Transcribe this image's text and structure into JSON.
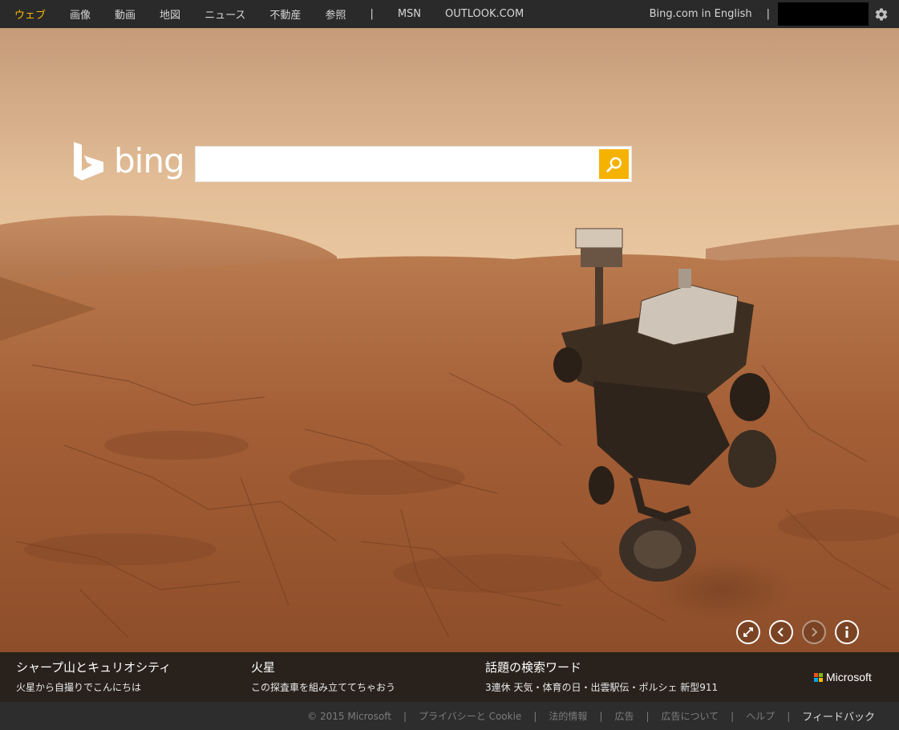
{
  "nav": {
    "items": [
      "ウェブ",
      "画像",
      "動画",
      "地図",
      "ニュース",
      "不動産",
      "参照"
    ],
    "separator": "|",
    "extra": [
      "MSN",
      "OUTLOOK.COM"
    ],
    "active_color": "#f5b800"
  },
  "header_right": {
    "language_link": "Bing.com in English",
    "separator": "|",
    "settings_icon": "gear-icon"
  },
  "logo": {
    "text": "bing",
    "icon": "bing-b-logo-icon"
  },
  "search": {
    "value": "",
    "placeholder": "",
    "button_icon": "search-icon",
    "button_color": "#f5b200"
  },
  "image_controls": {
    "icons": [
      "fullscreen-icon",
      "previous-icon",
      "next-icon",
      "info-icon"
    ]
  },
  "hotspots": [
    {
      "title": "シャープ山とキュリオシティ",
      "subtitle": "火星から自撮りでこんにちは"
    },
    {
      "title": "火星",
      "subtitle": "この探査車を組み立ててちゃおう"
    },
    {
      "title": "話題の検索ワード",
      "subtitle": "3連休 天気・体育の日・出雲駅伝・ポルシェ 新型911"
    }
  ],
  "brand": {
    "name": "Microsoft",
    "colors": [
      "#f25022",
      "#7fba00",
      "#00a4ef",
      "#ffb900"
    ]
  },
  "footer": {
    "copyright": "© 2015 Microsoft",
    "separator": "|",
    "links": [
      "プライバシーと Cookie",
      "法的情報",
      "広告",
      "広告について",
      "ヘルプ",
      "フィードバック"
    ]
  }
}
